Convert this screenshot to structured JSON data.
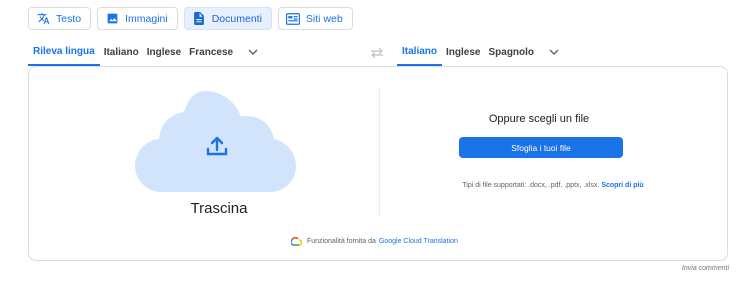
{
  "modes": [
    {
      "label": "Testo",
      "icon": "translate-icon",
      "active": false
    },
    {
      "label": "Immagini",
      "icon": "image-icon",
      "active": false
    },
    {
      "label": "Documenti",
      "icon": "document-icon",
      "active": true
    },
    {
      "label": "Siti web",
      "icon": "web-icon",
      "active": false
    }
  ],
  "source_langs": [
    "Rileva lingua",
    "Italiano",
    "Inglese",
    "Francese"
  ],
  "target_langs": [
    "Italiano",
    "Inglese",
    "Spagnolo"
  ],
  "drop_area": {
    "label": "Trascina"
  },
  "file_panel": {
    "or_choose": "Oppure scegli un file",
    "browse_button": "Sfoglia i tuoi file",
    "supported_types": "Tipi di file supportati: .docx, .pdf, .pptx, .xlsx.",
    "learn_more": "Scopri di più"
  },
  "powered_by": {
    "text": "Funzionalità fornita da",
    "link": "Google Cloud Translation"
  },
  "feedback": "Invia commenti",
  "colors": {
    "accent": "#1a73e8",
    "active_bg": "#e8f0fe",
    "cloud": "#d2e3fc",
    "border": "#dadce0"
  }
}
